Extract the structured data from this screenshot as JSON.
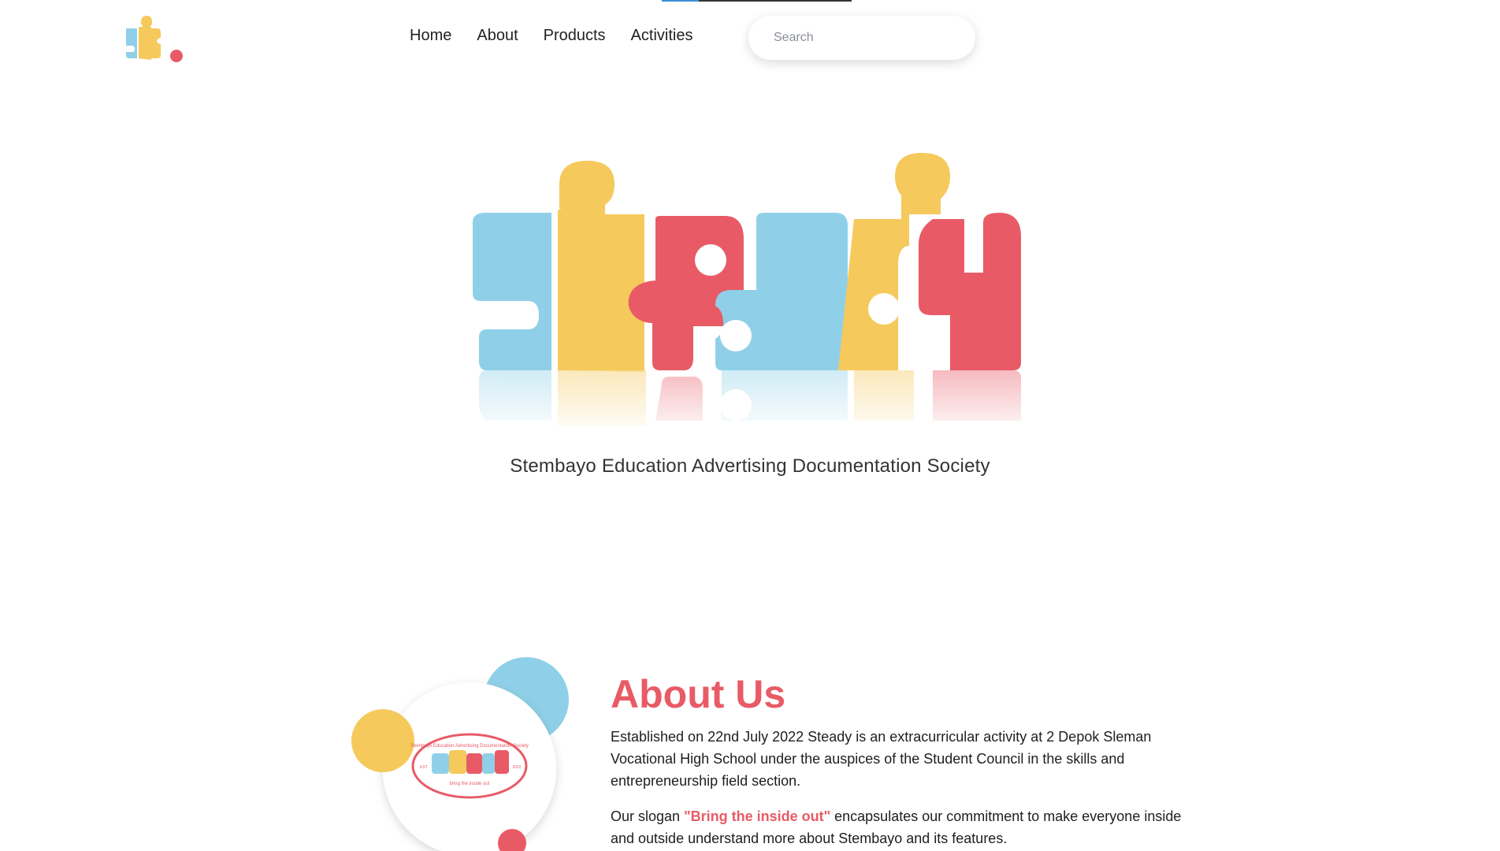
{
  "header": {
    "nav": [
      "Home",
      "About",
      "Products",
      "Activities"
    ],
    "search_placeholder": "Search"
  },
  "hero": {
    "tagline": "Stembayo Education Advertising Documentation Society"
  },
  "about": {
    "title": "About Us",
    "p1": "Established on 22nd July 2022 Steady is an extracurricular activity at 2 Depok Sleman Vocational High School under the auspices of the Student Council in the skills and entrepreneurship field section.",
    "p2_prefix": "Our slogan ",
    "slogan": "\"Bring the inside out\"",
    "p2_suffix": " encapsulates our commitment to make everyone inside and outside understand more about Stembayo and its features.",
    "badge_text": "Stembayo Education Advertising Documentation Society",
    "badge_sub": "bring the inside out",
    "badge_est": "EST",
    "badge_year": "2022"
  },
  "colors": {
    "blue": "#8fd0e8",
    "yellow": "#f5c95c",
    "red": "#e85b66"
  }
}
